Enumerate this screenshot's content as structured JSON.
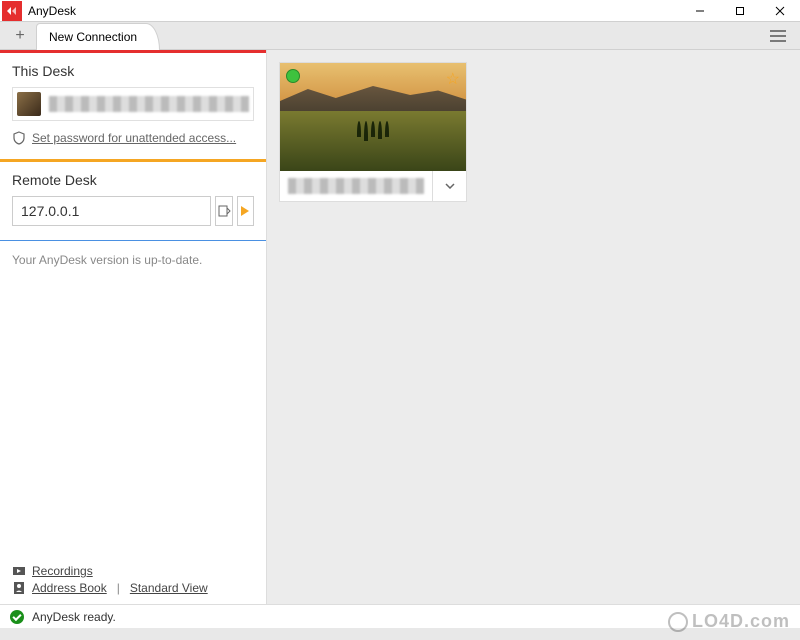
{
  "window": {
    "title": "AnyDesk"
  },
  "tabs": {
    "current": "New Connection"
  },
  "this_desk": {
    "heading": "This Desk",
    "password_link": "Set password for unattended access..."
  },
  "remote_desk": {
    "heading": "Remote Desk",
    "value": "127.0.0.1"
  },
  "update": {
    "message": "Your AnyDesk version is up-to-date."
  },
  "links": {
    "recordings": "Recordings",
    "address_book": "Address Book",
    "standard_view": "Standard View"
  },
  "status": {
    "text": "AnyDesk ready."
  },
  "watermark": "LO4D.com"
}
